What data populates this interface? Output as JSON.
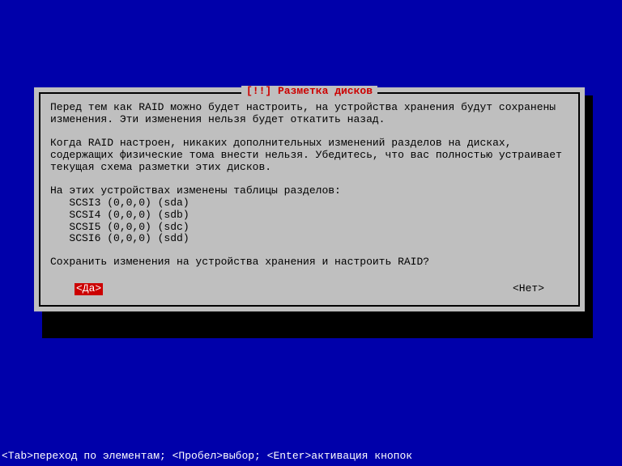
{
  "dialog": {
    "title": "[!!] Разметка дисков",
    "para1": "Перед тем как RAID можно будет настроить, на устройства хранения будут сохранены изменения. Эти изменения нельзя будет откатить назад.",
    "para2": "Когда RAID настроен, никаких дополнительных изменений разделов на дисках, содержащих физические тома внести нельзя. Убедитесь, что вас полностью устраивает текущая схема разметки этих дисков.",
    "changed_label": "На этих устройствах изменены таблицы разделов:",
    "devices": [
      "SCSI3 (0,0,0) (sda)",
      "SCSI4 (0,0,0) (sdb)",
      "SCSI5 (0,0,0) (sdc)",
      "SCSI6 (0,0,0) (sdd)"
    ],
    "question": "Сохранить изменения на устройства хранения и настроить RAID?",
    "yes": "<Да>",
    "no": "<Нет>"
  },
  "footer": "<Tab>переход по элементам; <Пробел>выбор; <Enter>активация кнопок"
}
